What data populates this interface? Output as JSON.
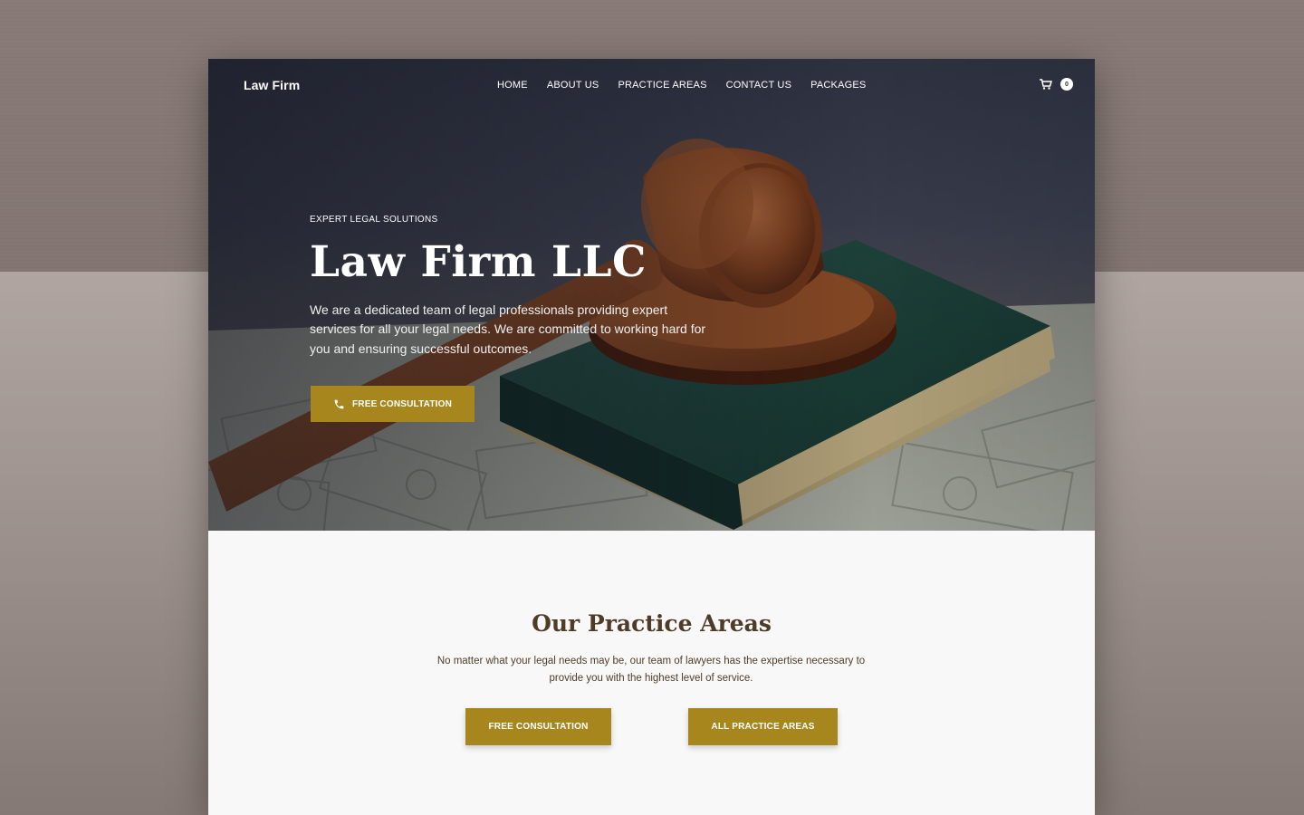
{
  "brand": {
    "name": "Law Firm"
  },
  "nav": {
    "items": [
      {
        "label": "HOME"
      },
      {
        "label": "ABOUT US"
      },
      {
        "label": "PRACTICE AREAS"
      },
      {
        "label": "CONTACT US"
      },
      {
        "label": "PACKAGES"
      }
    ],
    "cart_count": "0",
    "cart_icon": "cart-icon"
  },
  "hero": {
    "eyebrow": "EXPERT LEGAL SOLUTIONS",
    "title": "Law Firm LLC",
    "text": "We are a dedicated team of legal professionals providing expert services for all your legal needs. We are committed to working hard for you and ensuring successful outcomes.",
    "cta_label": "FREE CONSULTATION",
    "cta_icon": "phone-icon"
  },
  "practice": {
    "title": "Our Practice Areas",
    "text": "No matter what your legal needs may be, our team of lawyers has the  expertise necessary to provide you with the highest level of service.",
    "primary_label": "FREE CONSULTATION",
    "secondary_label": "ALL PRACTICE AREAS"
  },
  "colors": {
    "accent": "#a8861e",
    "heading": "#4e3c26",
    "hero_dark": "#2f3342"
  }
}
